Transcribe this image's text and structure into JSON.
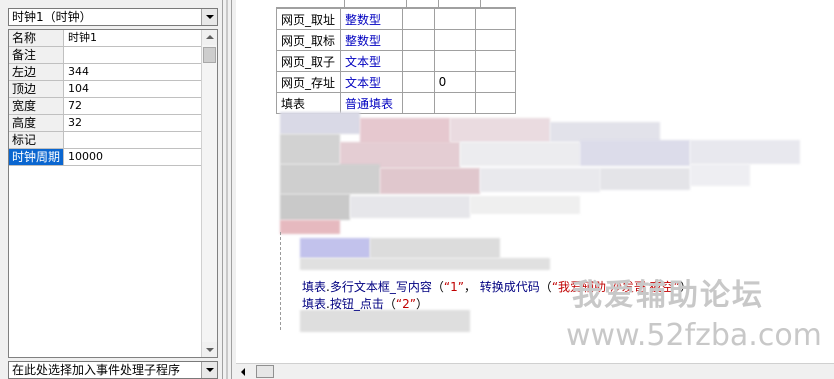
{
  "properties_panel": {
    "object_selector": "时钟1（时钟）",
    "rows": [
      {
        "name": "名称",
        "value": "时钟1"
      },
      {
        "name": "备注",
        "value": ""
      },
      {
        "name": "左边",
        "value": "344"
      },
      {
        "name": "顶边",
        "value": "104"
      },
      {
        "name": "宽度",
        "value": "72"
      },
      {
        "name": "高度",
        "value": "32"
      },
      {
        "name": "标记",
        "value": ""
      },
      {
        "name": "时钟周期",
        "value": "10000"
      }
    ],
    "selected_row": "时钟周期",
    "event_selector": "在此处选择加入事件处理子程序"
  },
  "declarations_table": {
    "rows": [
      {
        "name": "网页_取址",
        "type": "整数型",
        "c3": "",
        "c4": "",
        "c5": ""
      },
      {
        "name": "网页_取标",
        "type": "整数型",
        "c3": "",
        "c4": "",
        "c5": ""
      },
      {
        "name": "网页_取子",
        "type": "文本型",
        "c3": "",
        "c4": "",
        "c5": ""
      },
      {
        "name": "网页_存址",
        "type": "文本型",
        "c3": "",
        "c4": "0",
        "c5": ""
      },
      {
        "name": "填表",
        "type": "普通填表",
        "c3": "",
        "c4": "",
        "c5": ""
      }
    ]
  },
  "code_lines": {
    "line1": {
      "obj": "填表",
      "dot": ".",
      "method": "多行文本框_写内容",
      "open": "（",
      "arg1": "“1”",
      "sep": "， ",
      "fn": "转换成代码",
      "open2": "（",
      "arg2": "“我爱辅助 沙发哥 夜空”",
      "close": "））"
    },
    "line2": {
      "obj": "填表",
      "dot": ".",
      "method": "按钮_点击",
      "open": "（",
      "arg1": "“2”",
      "close": "）"
    }
  },
  "watermark": {
    "text_cn": "我爱辅助论坛",
    "url": "www.52fzba.com"
  }
}
